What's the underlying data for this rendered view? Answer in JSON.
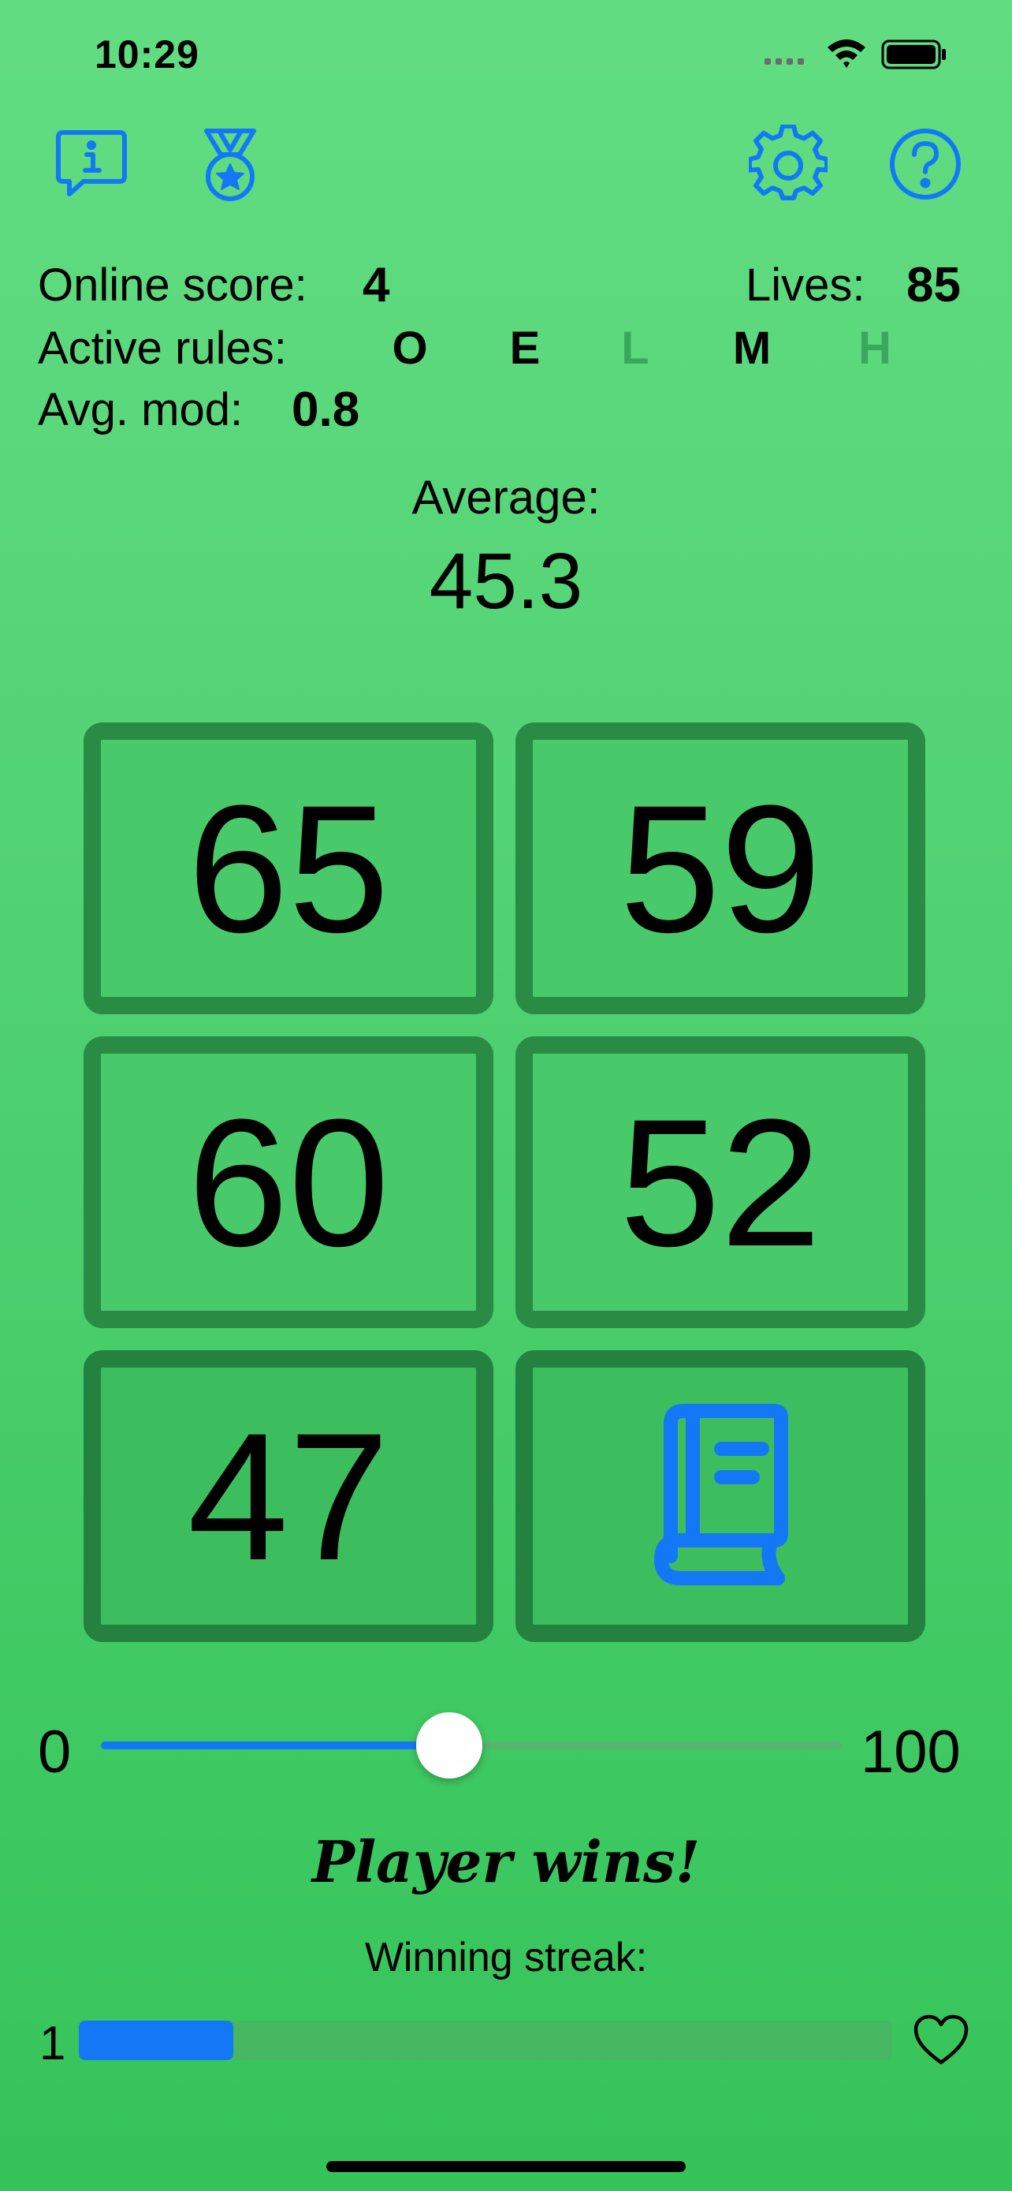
{
  "status_bar": {
    "time": "10:29"
  },
  "toolbar": {
    "left_icons": [
      "info-bubble-icon",
      "medal-icon"
    ],
    "right_icons": [
      "gear-icon",
      "question-icon"
    ]
  },
  "info": {
    "online_score_label": "Online score:",
    "online_score_value": "4",
    "lives_label": "Lives:",
    "lives_value": "85",
    "active_rules_label": "Active rules:",
    "rules": [
      {
        "letter": "O",
        "active": true
      },
      {
        "letter": "E",
        "active": true
      },
      {
        "letter": "L",
        "active": false
      },
      {
        "letter": "M",
        "active": true
      },
      {
        "letter": "H",
        "active": false
      }
    ],
    "avg_mod_label": "Avg. mod:",
    "avg_mod_value": "0.8"
  },
  "average": {
    "label": "Average:",
    "value": "45.3"
  },
  "cards": [
    "65",
    "59",
    "60",
    "52",
    "47"
  ],
  "rulebook_icon": "book-icon",
  "slider": {
    "min": "0",
    "max": "100",
    "value": 47
  },
  "result": {
    "text": "Player wins!"
  },
  "streak": {
    "label": "Winning streak:",
    "count": "1",
    "progress": 0.19,
    "heart_icon": "heart-icon"
  },
  "colors": {
    "accent": "#1478f6",
    "card_border": "#2a8b45",
    "background_top": "#62dd82",
    "background_bottom": "#35c459",
    "inactive_rule": "#3aa85c"
  }
}
